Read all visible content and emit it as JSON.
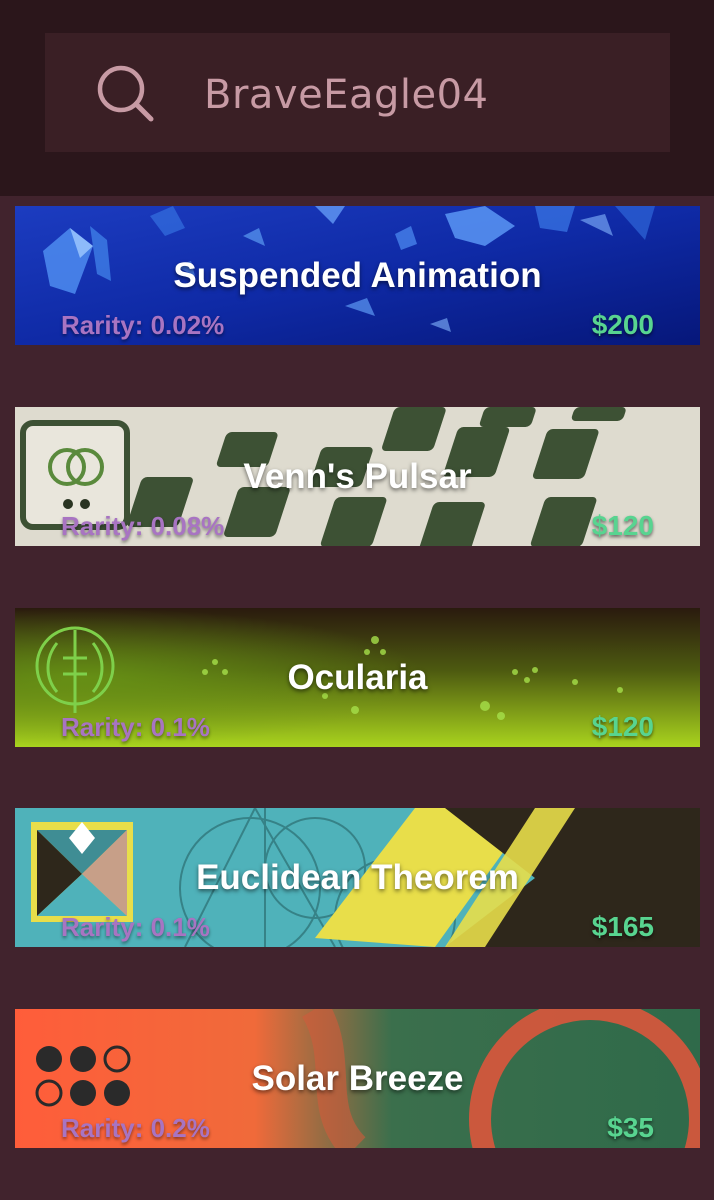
{
  "search": {
    "value": "BraveEagle04",
    "icon": "search-icon"
  },
  "items": [
    {
      "title": "Suspended Animation",
      "rarity": "Rarity: 0.02%",
      "price": "$200",
      "theme": "blue-crystals"
    },
    {
      "title": "Venn's Pulsar",
      "rarity": "Rarity: 0.08%",
      "price": "$120",
      "theme": "checker-beige"
    },
    {
      "title": "Ocularia",
      "rarity": "Rarity: 0.1%",
      "price": "$120",
      "theme": "green-glow"
    },
    {
      "title": "Euclidean Theorem",
      "rarity": "Rarity: 0.1%",
      "price": "$165",
      "theme": "teal-geometry"
    },
    {
      "title": "Solar Breeze",
      "rarity": "Rarity: 0.2%",
      "price": "$35",
      "theme": "orange-green"
    }
  ],
  "colors": {
    "background": "#41232d",
    "topbar": "#2b161b",
    "search_box": "#3a1f25",
    "search_text": "#c79aa4",
    "rarity_text": "#a874c2",
    "price_text": "#58d490"
  }
}
